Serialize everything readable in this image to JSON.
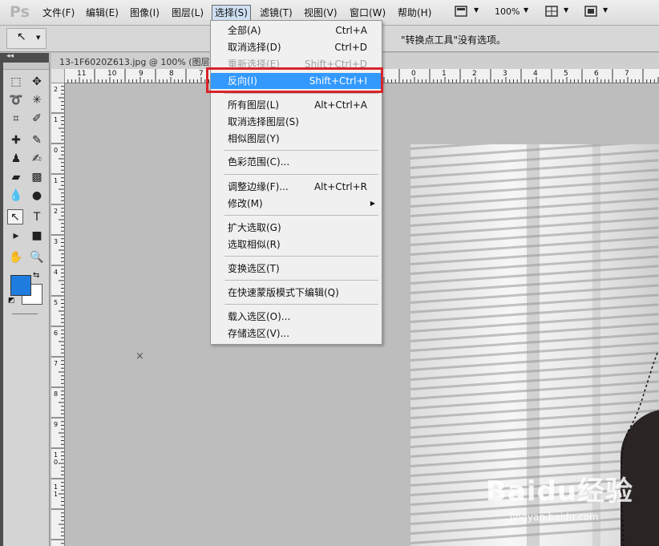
{
  "app": {
    "logo": "Ps"
  },
  "menubar": {
    "items": [
      "文件(F)",
      "编辑(E)",
      "图像(I)",
      "图层(L)",
      "选择(S)",
      "滤镜(T)",
      "视图(V)",
      "窗口(W)",
      "帮助(H)"
    ],
    "zoom": "100%"
  },
  "options_bar": {
    "message": "\"转换点工具\"没有选项。"
  },
  "document": {
    "tab_label": "13-1F6020Z613.jpg @ 100% (图层"
  },
  "rulers": {
    "h_labels": [
      "11",
      "10",
      "9",
      "8",
      "7",
      "0",
      "1",
      "2",
      "3",
      "4",
      "5",
      "6",
      "7"
    ],
    "v_labels": [
      "2",
      "1",
      "0",
      "1",
      "2",
      "3",
      "4",
      "5",
      "6",
      "7",
      "8",
      "9",
      "1 0",
      "1 1"
    ]
  },
  "select_menu": {
    "items": [
      {
        "label": "全部(A)",
        "shortcut": "Ctrl+A"
      },
      {
        "label": "取消选择(D)",
        "shortcut": "Ctrl+D"
      },
      {
        "label": "重新选择(E)",
        "shortcut": "Shift+Ctrl+D"
      },
      {
        "label": "反向(I)",
        "shortcut": "Shift+Ctrl+I"
      },
      {
        "label": "所有图层(L)",
        "shortcut": "Alt+Ctrl+A"
      },
      {
        "label": "取消选择图层(S)",
        "shortcut": ""
      },
      {
        "label": "相似图层(Y)",
        "shortcut": ""
      },
      {
        "label": "色彩范围(C)...",
        "shortcut": ""
      },
      {
        "label": "调整边缘(F)...",
        "shortcut": "Alt+Ctrl+R"
      },
      {
        "label": "修改(M)",
        "shortcut": ""
      },
      {
        "label": "扩大选取(G)",
        "shortcut": ""
      },
      {
        "label": "选取相似(R)",
        "shortcut": ""
      },
      {
        "label": "变换选区(T)",
        "shortcut": ""
      },
      {
        "label": "在快速蒙版模式下编辑(Q)",
        "shortcut": ""
      },
      {
        "label": "载入选区(O)...",
        "shortcut": ""
      },
      {
        "label": "存储选区(V)...",
        "shortcut": ""
      }
    ]
  },
  "colors": {
    "foreground": "#1f7de0",
    "background": "#ffffff",
    "highlight": "#3399ff",
    "callout": "#d8232a"
  },
  "watermark": {
    "brand": "Baidu经验",
    "url": "jingyan.baidu.com"
  }
}
